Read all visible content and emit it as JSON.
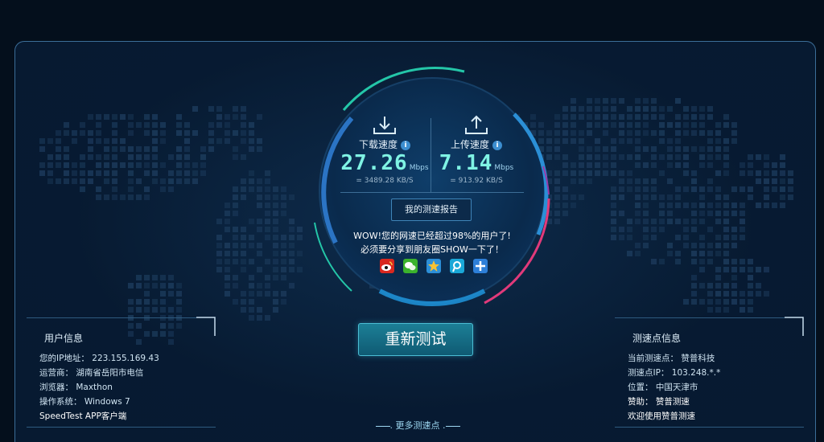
{
  "download": {
    "label": "下载速度",
    "value": "27.26",
    "unit": "Mbps",
    "kbs": "= 3489.28  KB/S"
  },
  "upload": {
    "label": "上传速度",
    "value": "7.14",
    "unit": "Mbps",
    "kbs": "= 913.92  KB/S"
  },
  "info_icon": "i",
  "report_button": "我的测速报告",
  "message": {
    "line1": "WOW!您的网速已经超过98%的用户了!",
    "line2": "必须要分享到朋友圈SHOW一下了！"
  },
  "share_icons": [
    "weibo-icon",
    "wechat-icon",
    "qzone-icon",
    "tencent-weibo-icon",
    "more-share-icon"
  ],
  "retest_button": "重新测试",
  "user_info": {
    "title": "用户信息",
    "ip": "您的IP地址： 223.155.169.43",
    "isp": "运营商： 湖南省岳阳市电信",
    "browser": "浏览器： Maxthon",
    "os": "操作系统： Windows 7",
    "app": "SpeedTest APP客户端"
  },
  "server_info": {
    "title": "测速点信息",
    "current": "当前测速点： 赞普科技",
    "ip": "测速点IP： 103.248.*.*",
    "location": "位置： 中国天津市",
    "sponsor": "赞助： 赞普测速",
    "welcome": "欢迎使用赞普测速"
  },
  "more_servers": ". 更多测速点 .",
  "colors": {
    "accent_teal": "#7ff3e4",
    "ring_teal": "#24c6a8",
    "ring_blue": "#2f8ed6",
    "ring_pink": "#e13a7a",
    "button_bg": "#1c7f96"
  }
}
